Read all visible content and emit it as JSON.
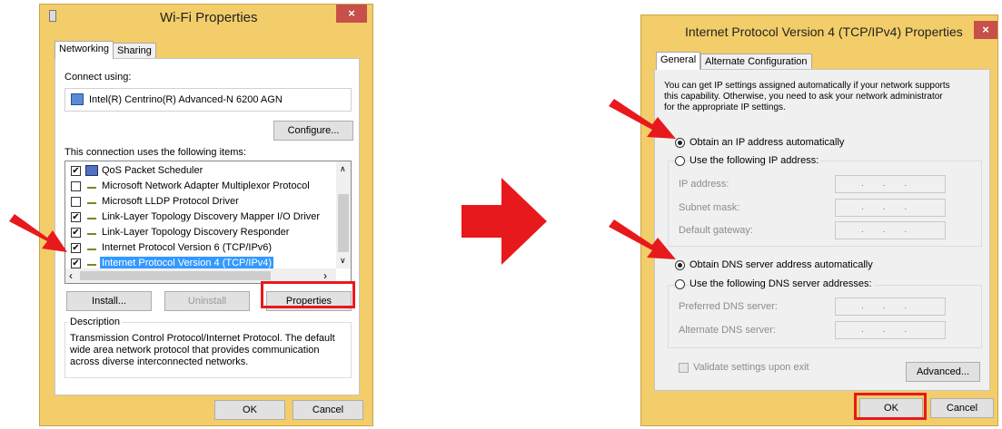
{
  "left_dialog": {
    "title": "Wi-Fi Properties",
    "close": "×",
    "tabs": [
      "Networking",
      "Sharing"
    ],
    "connect_using_label": "Connect using:",
    "adapter_name": "Intel(R) Centrino(R) Advanced-N 6200 AGN",
    "configure_label": "Configure...",
    "items_label": "This connection uses the following items:",
    "items": [
      {
        "label": "QoS Packet Scheduler",
        "checked": true
      },
      {
        "label": "Microsoft Network Adapter Multiplexor Protocol",
        "checked": false
      },
      {
        "label": "Microsoft LLDP Protocol Driver",
        "checked": false
      },
      {
        "label": "Link-Layer Topology Discovery Mapper I/O Driver",
        "checked": true
      },
      {
        "label": "Link-Layer Topology Discovery Responder",
        "checked": true
      },
      {
        "label": "Internet Protocol Version 6 (TCP/IPv6)",
        "checked": true
      },
      {
        "label": "Internet Protocol Version 4 (TCP/IPv4)",
        "checked": true,
        "selected": true
      }
    ],
    "install_label": "Install...",
    "uninstall_label": "Uninstall",
    "properties_label": "Properties",
    "description_label": "Description",
    "description_lines": [
      "Transmission Control Protocol/Internet Protocol. The default",
      "wide area network protocol that provides communication",
      "across diverse interconnected networks."
    ],
    "ok_label": "OK",
    "cancel_label": "Cancel"
  },
  "right_dialog": {
    "title": "Internet Protocol Version 4 (TCP/IPv4) Properties",
    "close": "×",
    "tabs": [
      "General",
      "Alternate Configuration"
    ],
    "intro_lines": [
      "You can get IP settings assigned automatically if your network supports",
      "this capability. Otherwise, you need to ask your network administrator",
      "for the appropriate IP settings."
    ],
    "obtain_ip_label": "Obtain an IP address automatically",
    "use_ip_label": "Use the following IP address:",
    "ip_address_label": "IP address:",
    "subnet_label": "Subnet mask:",
    "gateway_label": "Default gateway:",
    "obtain_dns_label": "Obtain DNS server address automatically",
    "use_dns_label": "Use the following DNS server addresses:",
    "preferred_dns_label": "Preferred DNS server:",
    "alternate_dns_label": "Alternate DNS server:",
    "ip_field_value": "...",
    "validate_label": "Validate settings upon exit",
    "advanced_label": "Advanced...",
    "ok_label": "OK",
    "cancel_label": "Cancel"
  },
  "colors": {
    "arrow": "#e8191c",
    "highlight_box": "#e8191c",
    "selection": "#3399ff",
    "title_bar": "#f3cd6a",
    "close_button": "#c7504b"
  }
}
